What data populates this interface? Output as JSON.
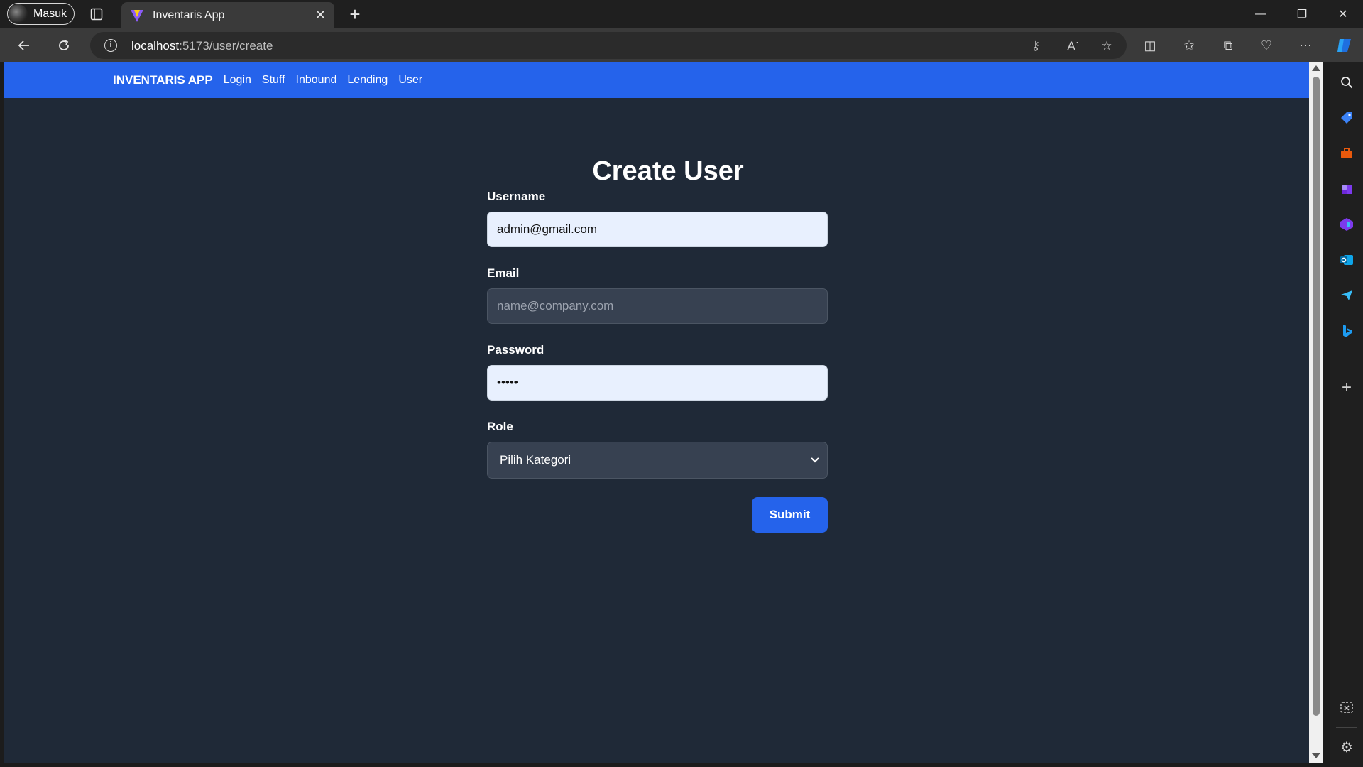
{
  "browser": {
    "profile_name": "Masuk",
    "tab_title": "Inventaris App",
    "url_host": "localhost",
    "url_path": ":5173/user/create"
  },
  "navbar": {
    "brand": "INVENTARIS APP",
    "links": [
      "Login",
      "Stuff",
      "Inbound",
      "Lending",
      "User"
    ]
  },
  "form": {
    "title": "Create User",
    "username_label": "Username",
    "username_value": "admin@gmail.com",
    "email_label": "Email",
    "email_placeholder": "name@company.com",
    "password_label": "Password",
    "password_value": "•••••",
    "role_label": "Role",
    "role_selected": "Pilih Kategori",
    "submit_label": "Submit"
  },
  "colors": {
    "navbar": "#2563eb",
    "page_bg": "#1f2937",
    "input_dark": "#374151",
    "input_light": "#e8f0fe"
  }
}
